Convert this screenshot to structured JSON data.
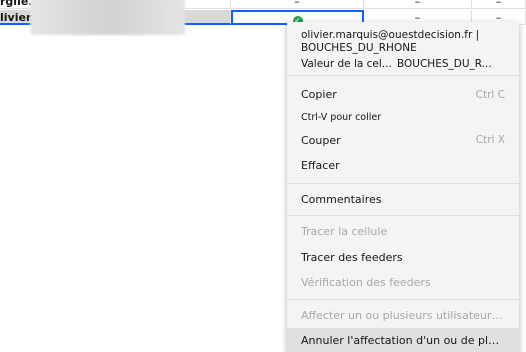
{
  "grid": {
    "row1_name": "rgile.",
    "row1_cells": [
      "–",
      "–",
      "–"
    ],
    "row2_name": "livier.",
    "row2_cells": [
      "–",
      "–"
    ]
  },
  "menu": {
    "info_email": "olivier.marquis@ouestdecision.fr |",
    "info_region": "BOUCHES_DU_RHONE",
    "info_value_key": "Valeur de la cel...",
    "info_value_val": "BOUCHES_DU_R...",
    "copy_label": "Copier",
    "copy_shortcut": "Ctrl C",
    "paste_hint": "Ctrl-V pour coller",
    "cut_label": "Couper",
    "cut_shortcut": "Ctrl X",
    "clear_label": "Effacer",
    "comments_label": "Commentaires",
    "trace_cell_label": "Tracer la cellule",
    "trace_feeders_label": "Tracer des feeders",
    "check_feeders_label": "Vérification des feeders",
    "assign_users_label": "Affecter un ou plusieurs utilisateurs à ...",
    "unassign_label": "Annuler l'affectation d'un ou de plusie..."
  },
  "colors": {
    "accent": "#0f62fe",
    "success": "#24a148",
    "menu_bg": "#f4f4f4",
    "disabled_text": "#a8a8a8"
  }
}
